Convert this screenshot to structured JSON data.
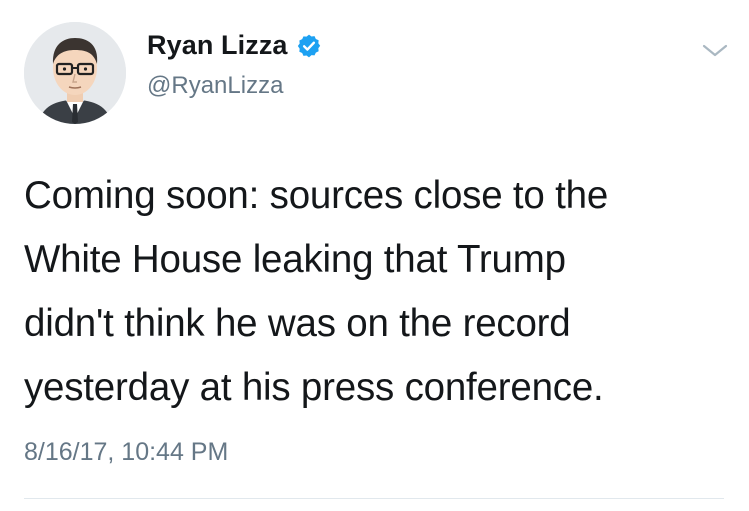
{
  "tweet": {
    "author": {
      "display_name": "Ryan Lizza",
      "handle": "@RyanLizza",
      "verified": true,
      "avatar_icon": "cartoon-man-glasses-avatar"
    },
    "text": "Coming soon: sources close to the\nWhite House leaking that Trump\ndidn't think he was on the record\nyesterday at his press conference.",
    "timestamp": "8/16/17, 10:44 PM",
    "menu_icon": "chevron-down-icon"
  },
  "colors": {
    "text_primary": "#14171a",
    "text_secondary": "#657786",
    "verified_blue": "#1da1f2",
    "divider": "#e1e8ed"
  }
}
